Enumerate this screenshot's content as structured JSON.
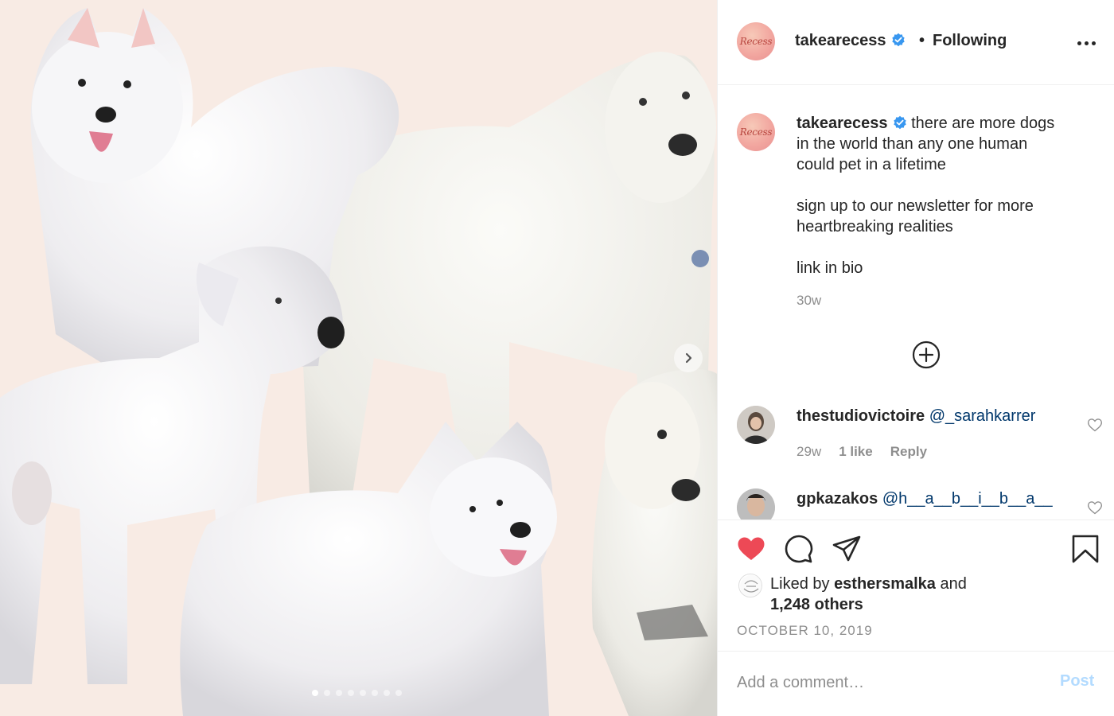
{
  "post": {
    "username": "takearecess",
    "avatar_text": "Recess",
    "separator": "•",
    "follow_status": "Following",
    "carousel": {
      "slide_count": 8,
      "active_index": 0
    }
  },
  "caption": {
    "username": "takearecess",
    "lines": [
      "there are more dogs",
      "in the world than any one human",
      "could pet in a lifetime",
      "",
      "sign up to our newsletter for more",
      "heartbreaking realities",
      "",
      "link in bio"
    ],
    "time": "30w"
  },
  "comments": [
    {
      "username": "thestudiovictoire",
      "text": "@_sarahkarrer",
      "time": "29w",
      "likes": "1 like",
      "reply": "Reply"
    },
    {
      "username": "gpkazakos",
      "text": "@h__a__b__i__b__a__"
    }
  ],
  "likes": {
    "prefix": "Liked by",
    "user": "esthersmalka",
    "and": "and",
    "others": "1,248 others"
  },
  "date": "OCTOBER 10, 2019",
  "add_comment": {
    "placeholder": "Add a comment…",
    "post_label": "Post"
  },
  "colors": {
    "like_red": "#ed4956",
    "verified_blue": "#3897f0",
    "link_blue": "#00376b",
    "post_disabled": "#b3dbff",
    "media_bg": "#f8ebe4"
  },
  "icons": [
    "verified-badge-icon",
    "more-options-icon",
    "chevron-right-icon",
    "plus-circle-icon",
    "heart-filled-icon",
    "comment-icon",
    "share-icon",
    "bookmark-icon",
    "heart-outline-icon"
  ]
}
